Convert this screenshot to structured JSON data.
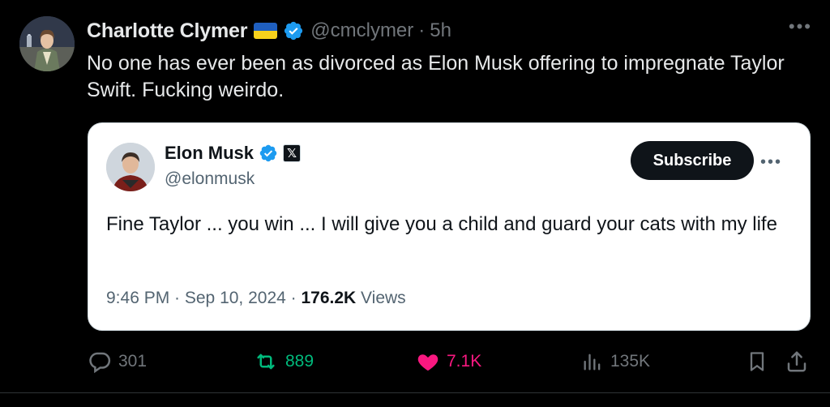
{
  "author": {
    "display_name": "Charlotte Clymer",
    "handle": "@cmclymer",
    "separator": "·",
    "time": "5h",
    "flag_colors": {
      "top": "#1f5fbf",
      "bottom": "#f7d21c"
    }
  },
  "tweet": {
    "text": "No one has ever been as divorced as Elon Musk offering to impregnate Taylor Swift. Fucking weirdo."
  },
  "quoted": {
    "display_name": "Elon Musk",
    "handle": "@elonmusk",
    "x_badge": "𝕏",
    "subscribe_label": "Subscribe",
    "text": "Fine Taylor ... you win ... I will give you a child and guard your cats with my life",
    "timestamp": "9:46 PM · Sep 10, 2024 · ",
    "views_count": "176.2K",
    "views_label": " Views"
  },
  "actions": {
    "replies": "301",
    "reposts": "889",
    "likes": "7.1K",
    "views": "135K"
  },
  "colors": {
    "background": "#000000",
    "verified": "#1d9bf0",
    "repost": "#00ba7c",
    "like": "#f91880",
    "muted": "#71767b"
  }
}
